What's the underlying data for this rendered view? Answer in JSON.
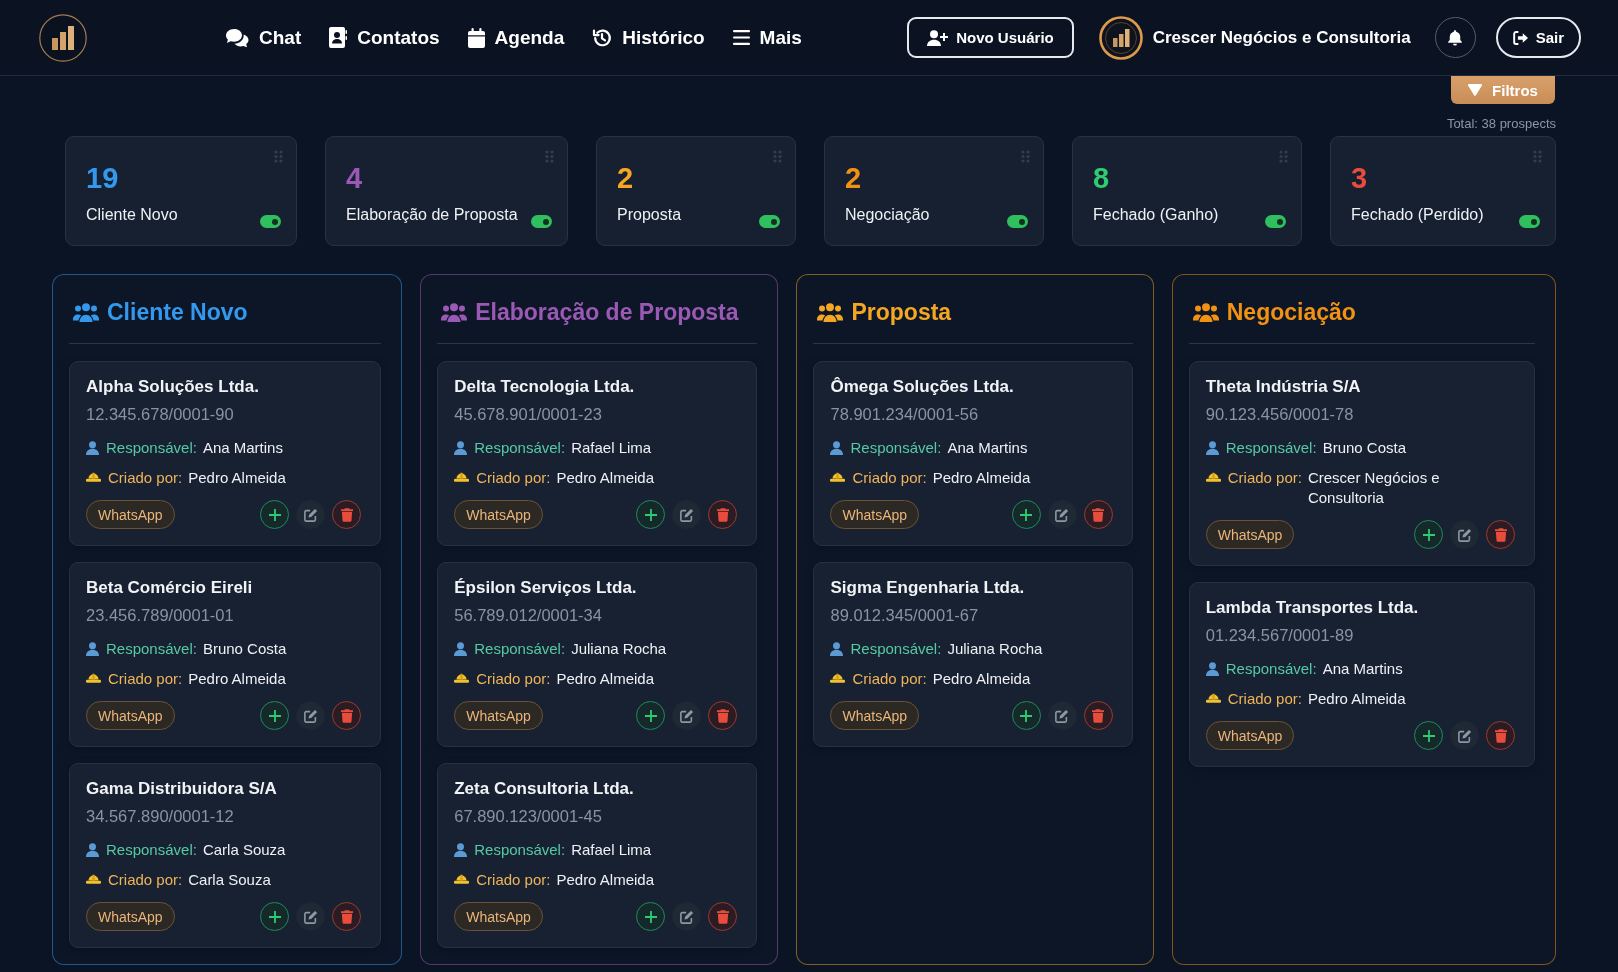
{
  "header": {
    "nav": [
      {
        "label": "Chat"
      },
      {
        "label": "Contatos"
      },
      {
        "label": "Agenda"
      },
      {
        "label": "Histórico"
      },
      {
        "label": "Mais"
      }
    ],
    "new_user_button": "Novo Usuário",
    "company_name": "Crescer Negócios e Consultoria",
    "logout_button": "Sair"
  },
  "filters": {
    "button": "Filtros",
    "total": "Total: 38 prospects"
  },
  "stages": [
    {
      "count": "19",
      "label": "Cliente Novo",
      "color": "#3399ee",
      "on": true
    },
    {
      "count": "4",
      "label": "Elaboração de Proposta",
      "color": "#9b59b6",
      "on": true
    },
    {
      "count": "2",
      "label": "Proposta",
      "color": "#f5a623",
      "on": true
    },
    {
      "count": "2",
      "label": "Negociação",
      "color": "#f39212",
      "on": true
    },
    {
      "count": "8",
      "label": "Fechado (Ganho)",
      "color": "#2ecc71",
      "on": true
    },
    {
      "count": "3",
      "label": "Fechado (Perdido)",
      "color": "#e74c3c",
      "on": true
    }
  ],
  "columns": [
    {
      "title": "Cliente Novo",
      "color": "#3399ee",
      "cards": [
        {
          "name": "Alpha Soluções Ltda.",
          "cnpj": "12.345.678/0001-90",
          "responsible_label": "Responsável:",
          "responsible": "Ana Martins",
          "creator_label": "Criado por:",
          "creator": "Pedro Almeida",
          "tag": "WhatsApp"
        },
        {
          "name": "Beta Comércio Eireli",
          "cnpj": "23.456.789/0001-01",
          "responsible_label": "Responsável:",
          "responsible": "Bruno Costa",
          "creator_label": "Criado por:",
          "creator": "Pedro Almeida",
          "tag": "WhatsApp"
        },
        {
          "name": "Gama Distribuidora S/A",
          "cnpj": "34.567.890/0001-12",
          "responsible_label": "Responsável:",
          "responsible": "Carla Souza",
          "creator_label": "Criado por:",
          "creator": "Carla Souza",
          "tag": "WhatsApp"
        }
      ]
    },
    {
      "title": "Elaboração de Proposta",
      "color": "#9b59b6",
      "cards": [
        {
          "name": "Delta Tecnologia Ltda.",
          "cnpj": "45.678.901/0001-23",
          "responsible_label": "Responsável:",
          "responsible": "Rafael Lima",
          "creator_label": "Criado por:",
          "creator": "Pedro Almeida",
          "tag": "WhatsApp"
        },
        {
          "name": "Épsilon Serviços Ltda.",
          "cnpj": "56.789.012/0001-34",
          "responsible_label": "Responsável:",
          "responsible": "Juliana Rocha",
          "creator_label": "Criado por:",
          "creator": "Pedro Almeida",
          "tag": "WhatsApp"
        },
        {
          "name": "Zeta Consultoria Ltda.",
          "cnpj": "67.890.123/0001-45",
          "responsible_label": "Responsável:",
          "responsible": "Rafael Lima",
          "creator_label": "Criado por:",
          "creator": "Pedro Almeida",
          "tag": "WhatsApp"
        }
      ]
    },
    {
      "title": "Proposta",
      "color": "#f5a623",
      "cards": [
        {
          "name": "Ômega Soluções Ltda.",
          "cnpj": "78.901.234/0001-56",
          "responsible_label": "Responsável:",
          "responsible": "Ana Martins",
          "creator_label": "Criado por:",
          "creator": "Pedro Almeida",
          "tag": "WhatsApp"
        },
        {
          "name": "Sigma Engenharia Ltda.",
          "cnpj": "89.012.345/0001-67",
          "responsible_label": "Responsável:",
          "responsible": "Juliana Rocha",
          "creator_label": "Criado por:",
          "creator": "Pedro Almeida",
          "tag": "WhatsApp"
        }
      ]
    },
    {
      "title": "Negociação",
      "color": "#f39212",
      "cards": [
        {
          "name": "Theta Indústria S/A",
          "cnpj": "90.123.456/0001-78",
          "responsible_label": "Responsável:",
          "responsible": "Bruno Costa",
          "creator_label": "Criado por:",
          "creator": "Crescer Negócios e Consultoria",
          "tag": "WhatsApp"
        },
        {
          "name": "Lambda Transportes Ltda.",
          "cnpj": "01.234.567/0001-89",
          "responsible_label": "Responsável:",
          "responsible": "Ana Martins",
          "creator_label": "Criado por:",
          "creator": "Pedro Almeida",
          "tag": "WhatsApp"
        }
      ]
    }
  ]
}
